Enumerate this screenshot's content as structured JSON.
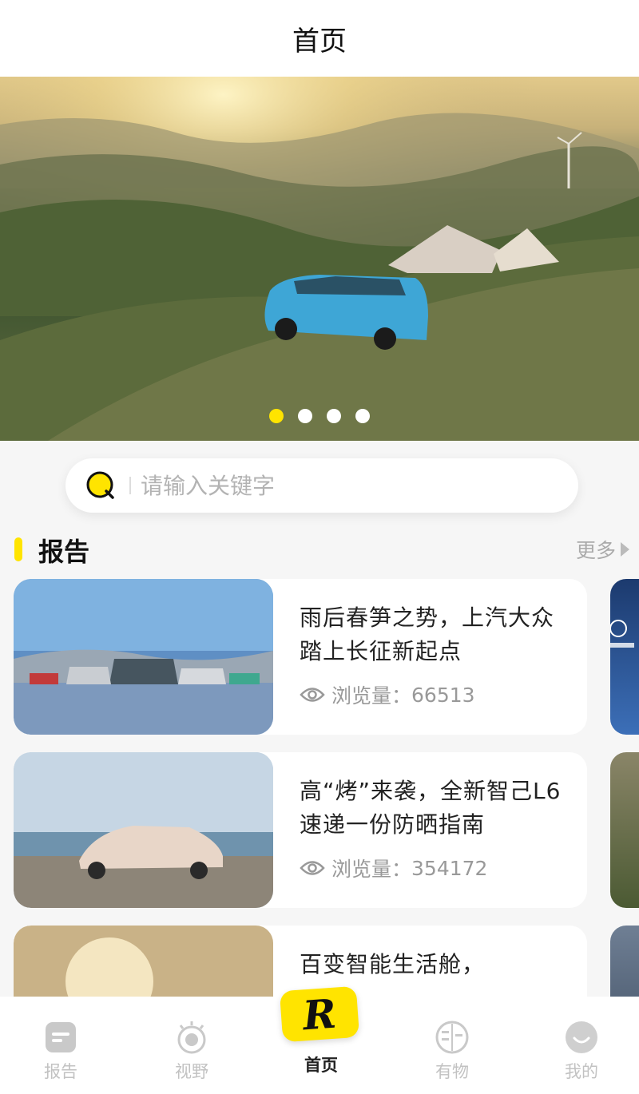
{
  "header": {
    "title": "首页"
  },
  "banner": {
    "slide_count": 4,
    "active_slide": 1
  },
  "search": {
    "placeholder": "请输入关键字",
    "value": ""
  },
  "section": {
    "title": "报告",
    "more_label": "更多"
  },
  "articles": [
    {
      "title": "雨后春笋之势，上汽大众踏上长征新起点",
      "views_label": "浏览量：",
      "views": "66513"
    },
    {
      "title": "高“烤”来袭，全新智己L6速递一份防晒指南",
      "views_label": "浏览量：",
      "views": "354172"
    },
    {
      "title": "百变智能生活舱，",
      "views_label": "",
      "views": ""
    }
  ],
  "tabbar": {
    "items": [
      {
        "label": "报告",
        "icon": "report-icon"
      },
      {
        "label": "视野",
        "icon": "eye-icon"
      },
      {
        "label": "首页",
        "icon": "home-r-icon"
      },
      {
        "label": "有物",
        "icon": "youwu-icon"
      },
      {
        "label": "我的",
        "icon": "smile-icon"
      }
    ],
    "active_index": 2,
    "home_badge": "R"
  },
  "colors": {
    "accent": "#ffe400",
    "muted": "#c2c2c2"
  }
}
